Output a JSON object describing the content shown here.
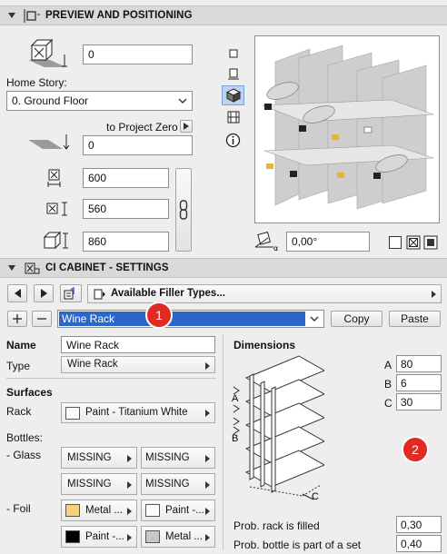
{
  "preview": {
    "header": "PREVIEW AND POSITIONING",
    "elevation_value": "0",
    "home_story_label": "Home Story:",
    "home_story_value": "0. Ground Floor",
    "to_project_zero_label": "to Project Zero",
    "project_zero_value": "0",
    "dim_x": "600",
    "dim_y": "560",
    "dim_z": "860",
    "angle_value": "0,00°"
  },
  "settings": {
    "header": "CI CABINET - SETTINGS",
    "available_filler_types": "Available Filler Types...",
    "rack_select_value": "Wine Rack",
    "copy_label": "Copy",
    "paste_label": "Paste",
    "badge1": "1",
    "badge2": "2",
    "name_label": "Name",
    "name_value": "Wine Rack",
    "type_label": "Type",
    "type_value": "Wine Rack",
    "surfaces_label": "Surfaces",
    "rack_label": "Rack",
    "rack_surface": "Paint - Titanium White",
    "bottles_label": "Bottles:",
    "glass_label": "- Glass",
    "glass": [
      "MISSING",
      "MISSING",
      "MISSING",
      "MISSING"
    ],
    "foil_label": "- Foil",
    "foil": [
      {
        "text": "Metal ...",
        "color": "#f5d27a"
      },
      {
        "text": "Paint -...",
        "color": "#ffffff"
      },
      {
        "text": "Paint -...",
        "color": "#000000"
      },
      {
        "text": "Metal ...",
        "color": "#c8c8c8"
      }
    ],
    "dimensions_label": "Dimensions",
    "dim_a_label": "A",
    "dim_a_value": "80",
    "dim_b_label": "B",
    "dim_b_value": "6",
    "dim_c_label": "C",
    "dim_c_value": "30",
    "diagram_a": "A",
    "diagram_b": "B",
    "diagram_c": "C",
    "prob_rack_label": "Prob. rack is filled",
    "prob_rack_value": "0,30",
    "prob_bottle_label": "Prob. bottle is part of a set",
    "prob_bottle_value": "0,40"
  },
  "colors": {
    "selected_bg": "#2a67c9",
    "badge": "#e22a22"
  }
}
